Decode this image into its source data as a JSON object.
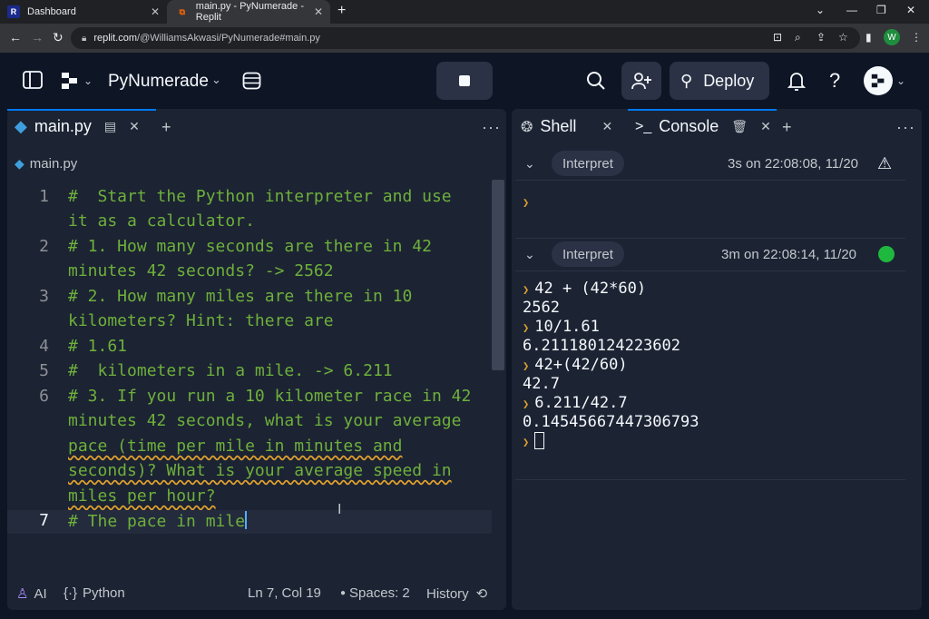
{
  "browser": {
    "tabs": [
      {
        "title": "Dashboard"
      },
      {
        "title": "main.py - PyNumerade - Replit"
      }
    ],
    "url_host": "replit.com",
    "url_path": "/@WilliamsAkwasi/PyNumerade#main.py",
    "profile_initial": "W"
  },
  "topbar": {
    "project_name": "PyNumerade",
    "deploy_label": "Deploy"
  },
  "editor": {
    "tab_label": "main.py",
    "breadcrumb": "main.py",
    "lines": [
      {
        "num": "1",
        "text": "#  Start the Python interpreter and use"
      },
      {
        "num": "",
        "text": "it as a calculator."
      },
      {
        "num": "2",
        "text": "# 1. How many seconds are there in 42"
      },
      {
        "num": "",
        "text": "minutes 42 seconds? -> 2562"
      },
      {
        "num": "3",
        "text": "# 2. How many miles are there in 10"
      },
      {
        "num": "",
        "text": "kilometers? Hint: there are"
      },
      {
        "num": "4",
        "text": "# 1.61"
      },
      {
        "num": "5",
        "text": "#  kilometers in a mile. -> 6.211"
      },
      {
        "num": "6",
        "text": "# 3. If you run a 10 kilometer race in 42"
      },
      {
        "num": "",
        "text": "minutes 42 seconds, what is your average"
      },
      {
        "num": "",
        "text": "pace (time per mile in minutes and"
      },
      {
        "num": "",
        "text": "seconds)? What is your average speed in"
      },
      {
        "num": "",
        "text": "miles per hour?"
      },
      {
        "num": "7",
        "text": "# The pace in mile"
      }
    ]
  },
  "statusbar": {
    "ai_label": "AI",
    "language": "Python",
    "position": "Ln 7, Col 19",
    "spaces": "Spaces: 2",
    "history": "History"
  },
  "right_pane": {
    "shell_tab": "Shell",
    "console_tab": "Console",
    "runs": [
      {
        "label": "Interpret",
        "time": "3s on 22:08:08, 11/20",
        "status": "warning"
      },
      {
        "label": "Interpret",
        "time": "3m on 22:08:14, 11/20",
        "status": "success"
      }
    ],
    "console_lines": [
      {
        "prompt": true,
        "text": "42 + (42*60)"
      },
      {
        "prompt": false,
        "text": "2562"
      },
      {
        "prompt": true,
        "text": "10/1.61"
      },
      {
        "prompt": false,
        "text": "6.211180124223602"
      },
      {
        "prompt": true,
        "text": "42+(42/60)"
      },
      {
        "prompt": false,
        "text": "42.7"
      },
      {
        "prompt": true,
        "text": "6.211/42.7"
      },
      {
        "prompt": false,
        "text": "0.14545667447306793"
      }
    ]
  },
  "colors": {
    "success": "#1fb83f",
    "code_comment": "#6eb03b",
    "accent": "#0079f2"
  }
}
